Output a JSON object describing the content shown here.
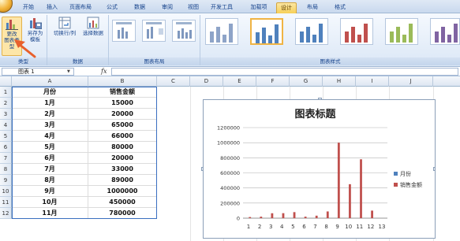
{
  "ribbon": {
    "tabs": [
      {
        "label": "开始",
        "active": false
      },
      {
        "label": "插入",
        "active": false
      },
      {
        "label": "页面布局",
        "active": false
      },
      {
        "label": "公式",
        "active": false
      },
      {
        "label": "数据",
        "active": false
      },
      {
        "label": "审阅",
        "active": false
      },
      {
        "label": "视图",
        "active": false
      },
      {
        "label": "开发工具",
        "active": false
      },
      {
        "label": "加载项",
        "active": false
      },
      {
        "label": "设计",
        "active": true
      },
      {
        "label": "布局",
        "active": false
      },
      {
        "label": "格式",
        "active": false
      }
    ],
    "type_group": {
      "change_type_label": "更改\n图表类型",
      "save_template_label": "另存为\n模板",
      "caption": "类型"
    },
    "data_group": {
      "switch_row_col_label": "切换行/列",
      "select_data_label": "选择数据",
      "caption": "数据"
    },
    "layout_group": {
      "caption": "图表布局"
    },
    "style_group": {
      "caption": "图表样式",
      "colors": [
        "#8ea4c8",
        "#4f81bd",
        "#c0504d",
        "#9bbb59",
        "#8064a2"
      ]
    }
  },
  "formula_bar": {
    "name_box": "图表 1",
    "fx_label": "fx",
    "value": ""
  },
  "sheet": {
    "columns": [
      "A",
      "B",
      "C",
      "D",
      "E",
      "F",
      "G",
      "H",
      "I",
      "J"
    ],
    "rows": [
      "1",
      "2",
      "3",
      "4",
      "5",
      "6",
      "7",
      "8",
      "9",
      "10",
      "11",
      "12"
    ],
    "header": {
      "month": "月份",
      "sales": "销售金额"
    },
    "data": [
      {
        "month": "1月",
        "sales": "15000"
      },
      {
        "month": "2月",
        "sales": "20000"
      },
      {
        "month": "3月",
        "sales": "65000"
      },
      {
        "month": "4月",
        "sales": "66000"
      },
      {
        "month": "5月",
        "sales": "80000"
      },
      {
        "month": "6月",
        "sales": "20000"
      },
      {
        "month": "7月",
        "sales": "33000"
      },
      {
        "month": "8月",
        "sales": "89000"
      },
      {
        "month": "9月",
        "sales": "1000000"
      },
      {
        "month": "10月",
        "sales": "450000"
      },
      {
        "month": "11月",
        "sales": "780000"
      }
    ]
  },
  "chart_data": {
    "type": "bar",
    "title": "图表标题",
    "categories": [
      "1",
      "2",
      "3",
      "4",
      "5",
      "6",
      "7",
      "8",
      "9",
      "10",
      "11",
      "12",
      "13"
    ],
    "series": [
      {
        "name": "月份",
        "color": "#4f81bd",
        "values": [
          1,
          2,
          3,
          4,
          5,
          6,
          7,
          8,
          9,
          10,
          11,
          12,
          0
        ]
      },
      {
        "name": "销售金额",
        "color": "#c0504d",
        "values": [
          15000,
          20000,
          65000,
          66000,
          80000,
          20000,
          33000,
          89000,
          1000000,
          450000,
          780000,
          100000,
          0
        ]
      }
    ],
    "ylim": [
      0,
      1200000
    ],
    "yticks": [
      "0",
      "200000",
      "400000",
      "600000",
      "800000",
      "1000000",
      "1200000"
    ],
    "legend": "right",
    "grid": true
  },
  "colors": {
    "accent": "#f0b444",
    "annotation_arrow": "#e8602c"
  }
}
